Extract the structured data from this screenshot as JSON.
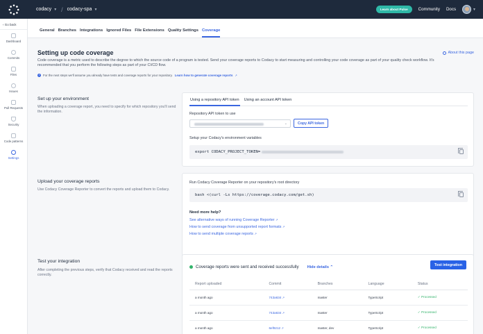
{
  "topbar": {
    "org": "codacy",
    "repo": "codacy-spa",
    "pulse_button": "Learn about Pulse",
    "community_link": "Community",
    "docs_link": "Docs"
  },
  "sidebar": {
    "go_back": "Go back",
    "items": [
      {
        "label": "Dashboard",
        "icon": "dashboard-icon"
      },
      {
        "label": "Commits",
        "icon": "commits-icon"
      },
      {
        "label": "Files",
        "icon": "files-icon"
      },
      {
        "label": "Issues",
        "icon": "issues-icon"
      },
      {
        "label": "Pull Requests",
        "icon": "pull-requests-icon"
      },
      {
        "label": "Security",
        "icon": "security-icon"
      },
      {
        "label": "Code patterns",
        "icon": "code-patterns-icon"
      },
      {
        "label": "Settings",
        "icon": "settings-icon"
      }
    ]
  },
  "tabs": [
    "General",
    "Branches",
    "Integrations",
    "Ignored Files",
    "File Extensions",
    "Quality Settings",
    "Coverage"
  ],
  "page": {
    "title": "Setting up code coverage",
    "about_link": "About this page",
    "description": "Code coverage is a metric used to describe the degree to which the source code of a program is tested. Send your coverage reports to Codacy to start measuring and controlling your code coverage as part of your quality check workflow. It's recommended that you perform the following steps as part of your CI/CD flow.",
    "note_text": "For the next steps we'll assume you already have tests and coverage reports for your repository.",
    "note_link": "Learn how to generate coverage reports"
  },
  "env": {
    "title": "Set up your environment",
    "desc": "When uploading a coverage report, you need to specify for which repository you'll send the information.",
    "tab_repo": "Using a repository API token",
    "tab_account": "Using an account API token",
    "token_label": "Repository API token to use",
    "copy_button": "Copy API token",
    "vars_label": "Setup your Codacy's environment variables",
    "code": "export CODACY_PROJECT_TOKEN="
  },
  "upload": {
    "title": "Upload your coverage reports",
    "desc": "Use Codacy Coverage Reporter to convert the reports and upload them to Codacy.",
    "run_label": "Run Codacy Coverage Reporter on your repository's root directory",
    "code": "bash <(curl -Ls https://coverage.codacy.com/get.sh)",
    "help_title": "Need more help?",
    "links": [
      "See alternative ways of running Coverage Reporter",
      "How to send coverage from unsupported report formats",
      "How to send multiple coverage reports"
    ]
  },
  "test": {
    "title": "Test your integration",
    "desc": "After completing the previous steps, verify that Codacy received and read the reports correctly.",
    "status": "Coverage reports were sent and received successfully",
    "hide_details": "Hide details",
    "test_button": "Test integration",
    "columns": [
      "Report uploaded",
      "Commit",
      "Branches",
      "Language",
      "Status"
    ],
    "rows": [
      {
        "uploaded": "a month ago",
        "commit": "743a634",
        "branches": "master",
        "language": "TypeScript",
        "status": "Processed"
      },
      {
        "uploaded": "a month ago",
        "commit": "743a634",
        "branches": "master",
        "language": "TypeScript",
        "status": "Processed"
      },
      {
        "uploaded": "a month ago",
        "commit": "6ef9212",
        "branches": "master, dev",
        "language": "TypeScript",
        "status": "Processed"
      }
    ]
  },
  "colors": {
    "accent": "#3a66e0",
    "topbar": "#1e2a3c",
    "pulse": "#2fb9a8",
    "success": "#33b36b"
  }
}
